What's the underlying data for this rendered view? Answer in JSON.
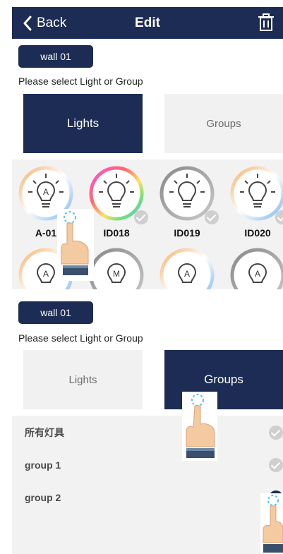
{
  "header": {
    "back_label": "Back",
    "title": "Edit"
  },
  "top_panel": {
    "wall_chip": "wall 01",
    "prompt": "Please select Light or Group",
    "tabs": {
      "lights": "Lights",
      "groups": "Groups",
      "active": "Lights"
    },
    "lights": [
      {
        "letter": "A",
        "label": "A-01",
        "ring": "warm",
        "checked": false
      },
      {
        "letter": "",
        "label": "ID018",
        "ring": "rainbow",
        "checked": true
      },
      {
        "letter": "",
        "label": "ID019",
        "ring": "gray",
        "checked": true
      },
      {
        "letter": "",
        "label": "ID020",
        "ring": "warm",
        "checked": true
      },
      {
        "letter": "A",
        "label": "",
        "ring": "warm",
        "checked": false
      },
      {
        "letter": "M",
        "label": "",
        "ring": "gray",
        "checked": false
      },
      {
        "letter": "A",
        "label": "",
        "ring": "warm",
        "checked": false
      },
      {
        "letter": "A",
        "label": "",
        "ring": "gray",
        "checked": false
      }
    ]
  },
  "bottom_panel": {
    "wall_chip": "wall 01",
    "prompt": "Please select Light or Group",
    "tabs": {
      "lights": "Lights",
      "groups": "Groups",
      "active": "Groups"
    },
    "groups": [
      {
        "label": "所有灯具",
        "selected": false
      },
      {
        "label": "group 1",
        "selected": false
      },
      {
        "label": "group 2",
        "selected": true
      }
    ]
  },
  "colors": {
    "navy": "#1c2c55",
    "light_gray": "#f2f2f2"
  }
}
